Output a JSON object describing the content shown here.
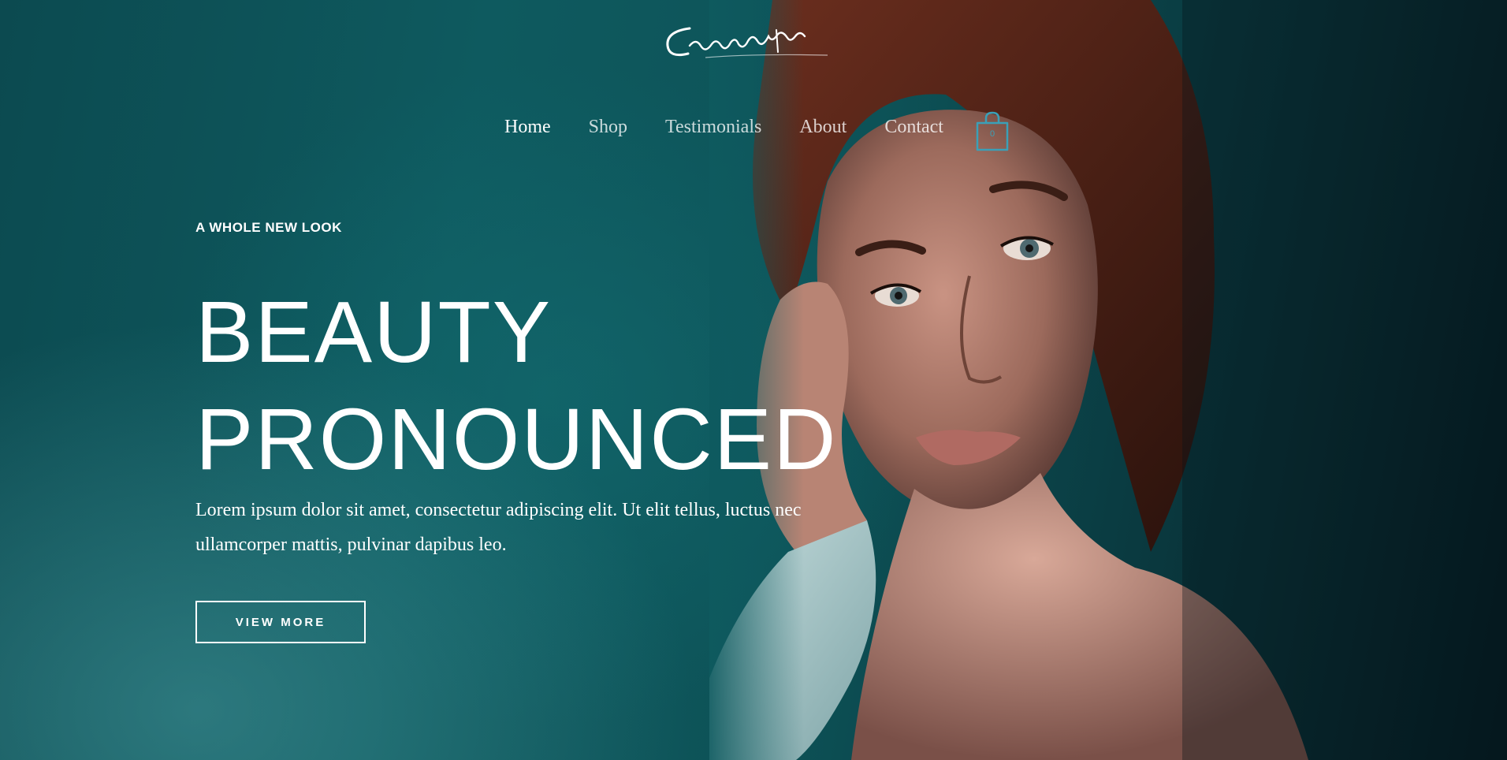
{
  "brand": {
    "logo_text": "Cosmetics"
  },
  "nav": {
    "items": [
      {
        "label": "Home",
        "active": true
      },
      {
        "label": "Shop",
        "active": false
      },
      {
        "label": "Testimonials",
        "active": false
      },
      {
        "label": "About",
        "active": false
      },
      {
        "label": "Contact",
        "active": false
      }
    ],
    "cart_count": "0",
    "cart_icon": "shopping-bag-icon"
  },
  "hero": {
    "eyebrow": "A WHOLE NEW LOOK",
    "headline_line1": "BEAUTY",
    "headline_line2": "PRONOUNCED",
    "body": "Lorem ipsum dolor sit amet, consectetur adipiscing elit. Ut elit tellus, luctus nec ullamcorper mattis, pulvinar dapibus leo.",
    "cta_label": "VIEW MORE"
  },
  "colors": {
    "background_teal": "#0e5a5f",
    "accent_cart": "#3aa0b8",
    "text": "#ffffff"
  }
}
